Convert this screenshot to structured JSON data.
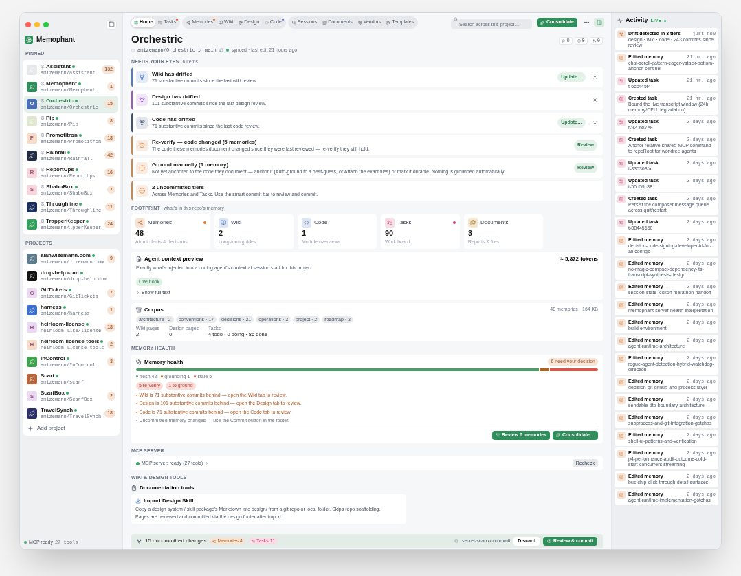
{
  "sidebar": {
    "brand": "Memophant",
    "pinned_label": "PINNED",
    "pinned": [
      {
        "name": "Assistant",
        "repo": "amizemann/assistant",
        "count": "132",
        "color": "#e5e7eb",
        "synced": true,
        "selected": false
      },
      {
        "name": "Memophant",
        "repo": "amizemann/Memophant",
        "count": "1",
        "color": "#2f8f5b",
        "synced": true,
        "selected": false
      },
      {
        "name": "Orchestric",
        "repo": "amizemann/Orchestric",
        "count": "15",
        "color": "#4a6fb5",
        "letter": "O",
        "synced": true,
        "selected": true
      },
      {
        "name": "Pip",
        "repo": "amizemann/Pip",
        "count": "8",
        "color": "#dfe8cf",
        "synced": true,
        "selected": false
      },
      {
        "name": "Promotitron",
        "repo": "amizemann/Promotitron",
        "count": "18",
        "color": "#f6dcc8",
        "letter": "P",
        "synced": true,
        "selected": false
      },
      {
        "name": "Rainfall",
        "repo": "amizemann/Rainfall",
        "count": "42",
        "color": "#1f2a44",
        "synced": true,
        "selected": false
      },
      {
        "name": "ReportUps",
        "repo": "amizemann/ReportUps",
        "count": "16",
        "color": "#f6d6dc",
        "letter": "R",
        "synced": true,
        "selected": false
      },
      {
        "name": "ShabuBox",
        "repo": "amizemann/ShabuBox",
        "count": "7",
        "color": "#f6d6dc",
        "letter": "S",
        "synced": true,
        "selected": false
      },
      {
        "name": "Throughline",
        "repo": "amizemann/Throughline",
        "count": "11",
        "color": "#1b2f5e",
        "synced": true,
        "selected": false
      },
      {
        "name": "TrapperKeeper",
        "repo": "amizemann/…pperKeeper",
        "count": "24",
        "color": "#2fa35a",
        "synced": true,
        "selected": false
      }
    ],
    "projects_label": "PROJECTS",
    "projects": [
      {
        "name": "alanwizemann.com",
        "repo": "amizemann/…izemann.com",
        "count": "9",
        "color": "#5b7a8c",
        "synced": true,
        "selected": false
      },
      {
        "name": "drop-help.com",
        "repo": "amizemann/drop-help.com",
        "color": "#111111",
        "synced": true,
        "selected": false
      },
      {
        "name": "GitTickets",
        "repo": "amizemann/GitTickets",
        "count": "7",
        "color": "#ead9f3",
        "letter": "G",
        "synced": true,
        "selected": false
      },
      {
        "name": "harness",
        "repo": "amizemann/harness",
        "count": "1",
        "color": "#3b6fd0",
        "synced": true,
        "selected": false
      },
      {
        "name": "heirloom-license",
        "repo": "heirloom l…se/license",
        "count": "18",
        "color": "#ead9f3",
        "letter": "H",
        "synced": true,
        "selected": false
      },
      {
        "name": "heirloom-license-tools",
        "repo": "heirloom l…cense-tools",
        "count": "2",
        "color": "#f6dcc8",
        "letter": "H",
        "synced": true,
        "selected": false
      },
      {
        "name": "InControl",
        "repo": "amizemann/InControl",
        "count": "3",
        "color": "#3fa34d",
        "synced": true,
        "selected": false
      },
      {
        "name": "Scarf",
        "repo": "amizemann/scarf",
        "color": "#b8643a",
        "synced": true,
        "selected": false
      },
      {
        "name": "ScarfBox",
        "repo": "amizemann/ScarfBox",
        "count": "2",
        "color": "#ead9f3",
        "letter": "S",
        "synced": true,
        "selected": false
      },
      {
        "name": "TravelSynch",
        "repo": "amizemann/TravelSynch",
        "count": "18",
        "color": "#2b2f6b",
        "synced": true,
        "selected": false
      }
    ],
    "add_project": "Add project",
    "status": {
      "label": "MCP ready",
      "tools": "27 tools"
    }
  },
  "tabs": [
    [
      {
        "label": "Home",
        "selected": true
      },
      {
        "label": "Tasks",
        "selected": false,
        "color": "#e0503f"
      }
    ],
    [
      {
        "label": "Memories",
        "selected": false,
        "color": "#e07a2f"
      },
      {
        "label": "Wiki",
        "selected": false
      },
      {
        "label": "Design",
        "selected": false
      },
      {
        "label": "Code",
        "selected": false,
        "color": "#5b7fc9"
      }
    ],
    [
      {
        "label": "Sessions",
        "selected": false
      },
      {
        "label": "Documents",
        "selected": false
      },
      {
        "label": "Vendors",
        "selected": false
      },
      {
        "label": "Templates",
        "selected": false
      }
    ]
  ],
  "search": {
    "placeholder": "Search across this project…"
  },
  "consolidate_button": "Consolidate",
  "header": {
    "title": "Orchestric",
    "repo": "amizemann/Orchestric",
    "branch": "main",
    "sync": "synced · last edit 21 hours ago",
    "counters": [
      "0",
      "0",
      "0"
    ]
  },
  "needs": {
    "label": "NEEDS YOUR EYES",
    "count": "6 items",
    "items": [
      {
        "kind": "drift",
        "color": "#4a7bd0",
        "title": "Wiki has drifted",
        "text": "71 substantive commits since the last wiki review.",
        "action": "Update…",
        "dismissible": true
      },
      {
        "kind": "drift",
        "color": "#9b59c9",
        "title": "Design has drifted",
        "text": "101 substantive commits since the last design review.",
        "dismissible": true
      },
      {
        "kind": "drift",
        "color": "#3d5478",
        "title": "Code has drifted",
        "text": "71 substantive commits since the last code review.",
        "action": "Update…",
        "dismissible": true
      },
      {
        "kind": "reverify",
        "color": "#d9823f",
        "title": "Re-verify — code changed (5 memories)",
        "text": "The code these memories document changed since they were last reviewed — re-verify they still hold.",
        "action": "Review",
        "dismissible": false
      },
      {
        "kind": "ground",
        "color": "#d9823f",
        "title": "Ground manually (1 memory)",
        "text": "Not yet anchored to the code they document — anchor it (Auto-ground to a best-guess, or Attach the exact files) or mark it durable. Nothing is grounded automatically.",
        "action": "Review",
        "dismissible": false
      },
      {
        "kind": "uncommitted",
        "color": "#d9823f",
        "title": "2 uncommitted tiers",
        "text": "Across Memories and Tasks. Use the smart commit bar to review and commit.",
        "dismissible": false
      }
    ]
  },
  "footprint": {
    "label": "FOOTPRINT",
    "subtitle": "what's in this repo's memory",
    "cards": [
      {
        "kind": "memories",
        "title": "Memories",
        "value": "48",
        "caption": "Atomic facts & decisions",
        "color": "#e07a2f"
      },
      {
        "kind": "wiki",
        "title": "Wiki",
        "value": "2",
        "caption": "Long-form guides"
      },
      {
        "kind": "code",
        "title": "Code",
        "value": "1",
        "caption": "Module overviews"
      },
      {
        "kind": "tasks",
        "title": "Tasks",
        "value": "90",
        "caption": "Work board",
        "color": "#d6456f"
      },
      {
        "kind": "documents",
        "title": "Documents",
        "value": "3",
        "caption": "Reports & files"
      }
    ]
  },
  "agent_context": {
    "title": "Agent context preview",
    "tokens": "≈ 5,872 tokens",
    "text": "Exactly what's injected into a coding agent's context at session start for this project.",
    "badge": "Live hook",
    "toggle": "Show full text"
  },
  "corpus": {
    "title": "Corpus",
    "summary": "48 memories · 164 KB",
    "tags": [
      "architecture · 2",
      "conventions · 17",
      "decisions · 21",
      "operations · 3",
      "project · 2",
      "roadmap · 3"
    ],
    "stats": [
      {
        "label": "Wiki pages",
        "value": "2"
      },
      {
        "label": "Design pages",
        "value": "0"
      },
      {
        "label": "Tasks",
        "value": "4 todo · 0 doing · 86 done"
      }
    ]
  },
  "health": {
    "label": "MEMORY HEALTH",
    "title": "Memory health",
    "badge": "6 need your decision",
    "segments": [
      {
        "label": "fresh",
        "count": "42",
        "color": "#4f9a6b"
      },
      {
        "label": "grounding",
        "count": "1",
        "color": "#b0641e"
      },
      {
        "label": "stale",
        "count": "5",
        "color": "#d9574a"
      }
    ],
    "pills": [
      "5 re-verify",
      "1 to ground"
    ],
    "notes": [
      {
        "kind": "warn",
        "text": "• Wiki is 71 substantive commits behind — open the Wiki tab to review."
      },
      {
        "kind": "warn",
        "text": "• Design is 101 substantive commits behind — open the Design tab to review."
      },
      {
        "kind": "warn",
        "text": "• Code is 71 substantive commits behind — open the Code tab to review."
      },
      {
        "kind": "info",
        "text": "• Uncommitted memory changes — use the Commit button in the footer."
      }
    ],
    "buttons": [
      "Review 6 memories",
      "Consolidate…"
    ]
  },
  "mcp": {
    "label": "MCP SERVER",
    "status": "MCP server: ready (27 tools)",
    "ready": true,
    "button": "Recheck"
  },
  "tools": {
    "label": "WIKI & DESIGN TOOLS",
    "heading": "Documentation tools",
    "card": {
      "title": "Import Design Skill",
      "lines": [
        "Copy a design system / skill package's Markdown into design/ from a git repo or local folder. Skips repo scaffolding.",
        "Pages are reviewed and committed via the design footer after import."
      ]
    }
  },
  "commit_bar": {
    "title": "15 uncommitted changes",
    "chips": [
      {
        "kind": "memories",
        "label": "Memories 4"
      },
      {
        "kind": "tasks",
        "label": "Tasks 11"
      }
    ],
    "scan": "secret-scan on commit",
    "discard": "Discard",
    "commit": "Review & commit"
  },
  "activity": {
    "title": "Activity",
    "live": "LIVE",
    "items": [
      {
        "kind": "drift",
        "title": "Drift detected in 3 tiers",
        "time": "just now",
        "text": "design · wiki · code · 243 commits since review"
      },
      {
        "kind": "memory",
        "title": "Edited memory",
        "time": "21 hr. ago",
        "text": "chat-scroll-pattern-eager-vstack-bottom-anchor-sentinel"
      },
      {
        "kind": "task_updated",
        "title": "Updated task",
        "time": "21 hr. ago",
        "text": "t-6cc445f4"
      },
      {
        "kind": "task_created",
        "title": "Created task",
        "time": "21 hr. ago",
        "text": "Bound the live transcript window (24h memory/CPU degradation)"
      },
      {
        "kind": "task_updated",
        "title": "Updated task",
        "time": "2 days ago",
        "text": "t-920b87e8"
      },
      {
        "kind": "task_created",
        "title": "Created task",
        "time": "2 days ago",
        "text": "Anchor relative shared-MCP command to repoRoot for worktree agents"
      },
      {
        "kind": "task_updated",
        "title": "Updated task",
        "time": "2 days ago",
        "text": "t-836303fa"
      },
      {
        "kind": "task_updated",
        "title": "Updated task",
        "time": "2 days ago",
        "text": "t-50d59c88"
      },
      {
        "kind": "task_created",
        "title": "Created task",
        "time": "2 days ago",
        "text": "Persist the composer message queue across quit/restart"
      },
      {
        "kind": "task_updated",
        "title": "Updated task",
        "time": "2 days ago",
        "text": "t-88445650"
      },
      {
        "kind": "memory",
        "title": "Edited memory",
        "time": "2 days ago",
        "text": "decision-code-signing-developer-id-for-all-configs"
      },
      {
        "kind": "memory",
        "title": "Edited memory",
        "time": "2 days ago",
        "text": "no-magic-compact-dependency-lts-transcript-synthesis-design"
      },
      {
        "kind": "memory",
        "title": "Edited memory",
        "time": "2 days ago",
        "text": "session-state-kickoff-marathon-handoff"
      },
      {
        "kind": "memory",
        "title": "Edited memory",
        "time": "2 days ago",
        "text": "memophant-server-health-interpretation"
      },
      {
        "kind": "memory",
        "title": "Edited memory",
        "time": "2 days ago",
        "text": "build-environment"
      },
      {
        "kind": "memory",
        "title": "Edited memory",
        "time": "2 days ago",
        "text": "agent-runtime-architecture"
      },
      {
        "kind": "memory",
        "title": "Edited memory",
        "time": "2 days ago",
        "text": "rogue-agent-detection-hybrid-watchdog-direction"
      },
      {
        "kind": "memory",
        "title": "Edited memory",
        "time": "2 days ago",
        "text": "decision-git-github-and-process-layer"
      },
      {
        "kind": "memory",
        "title": "Edited memory",
        "time": "2 days ago",
        "text": "sendable-dto-boundary-architecture"
      },
      {
        "kind": "memory",
        "title": "Edited memory",
        "time": "2 days ago",
        "text": "subprocess-and-git-integration-gotchas"
      },
      {
        "kind": "memory",
        "title": "Edited memory",
        "time": "2 days ago",
        "text": "shell-ui-patterns-and-verification"
      },
      {
        "kind": "memory",
        "title": "Edited memory",
        "time": "2 days ago",
        "text": "p4-performance-audit-outcome-cold-start-concurrent-streaming"
      },
      {
        "kind": "memory",
        "title": "Edited memory",
        "time": "2 days ago",
        "text": "bus-chip-click-through-detail-surfaces"
      },
      {
        "kind": "memory",
        "title": "Edited memory",
        "time": "2 days ago",
        "text": "agent-runtime-implementation-gotchas"
      }
    ]
  }
}
